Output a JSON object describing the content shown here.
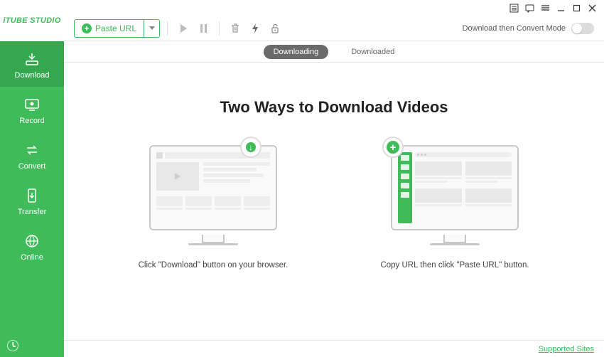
{
  "app_name": "iTUBE STUDIO",
  "sidebar": {
    "items": [
      {
        "label": "Download",
        "icon": "download-icon"
      },
      {
        "label": "Record",
        "icon": "record-icon"
      },
      {
        "label": "Convert",
        "icon": "convert-icon"
      },
      {
        "label": "Transfer",
        "icon": "transfer-icon"
      },
      {
        "label": "Online",
        "icon": "online-icon"
      }
    ]
  },
  "toolbar": {
    "paste_label": "Paste URL",
    "convert_toggle_label": "Download then Convert Mode"
  },
  "tabs": {
    "downloading": "Downloading",
    "downloaded": "Downloaded",
    "active": "downloading"
  },
  "content": {
    "headline": "Two Ways to Download Videos",
    "method1_caption": "Click \"Download\" button on your browser.",
    "method2_caption": "Copy URL then click \"Paste URL\" button."
  },
  "footer": {
    "supported_sites": "Supported Sites"
  },
  "colors": {
    "accent": "#3fbb5a"
  }
}
